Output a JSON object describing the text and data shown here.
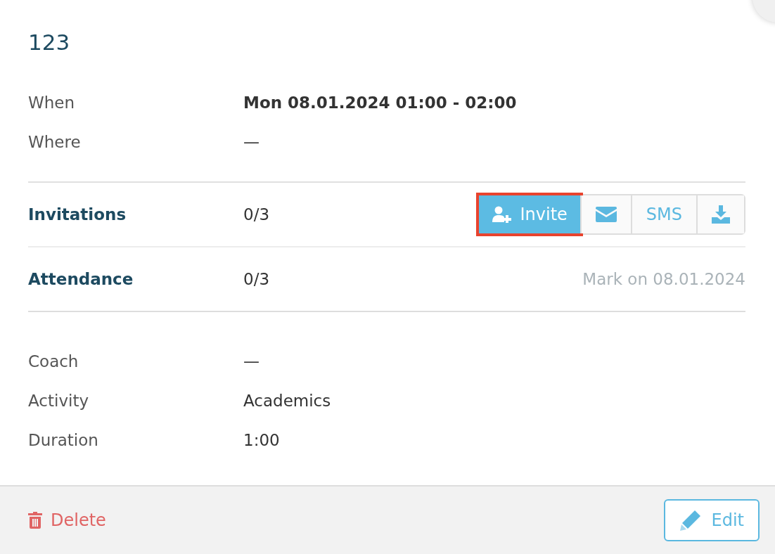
{
  "title": "123",
  "details_top": [
    {
      "label": "When",
      "value": "Mon 08.01.2024 01:00 - 02:00",
      "bold": true
    },
    {
      "label": "Where",
      "value": "—",
      "bold": false
    }
  ],
  "invitations": {
    "label": "Invitations",
    "count": "0/3",
    "buttons": [
      {
        "kind": "invite",
        "label": "Invite",
        "highlighted": true
      },
      {
        "kind": "email",
        "highlighted": false
      },
      {
        "kind": "sms",
        "label": "SMS",
        "highlighted": false
      },
      {
        "kind": "download",
        "highlighted": false
      }
    ]
  },
  "attendance": {
    "label": "Attendance",
    "count": "0/3",
    "note": "Mark on 08.01.2024"
  },
  "details_bottom": [
    {
      "label": "Coach",
      "value": "—"
    },
    {
      "label": "Activity",
      "value": "Academics"
    },
    {
      "label": "Duration",
      "value": "1:00"
    }
  ],
  "footer": {
    "delete": "Delete",
    "edit": "Edit"
  }
}
